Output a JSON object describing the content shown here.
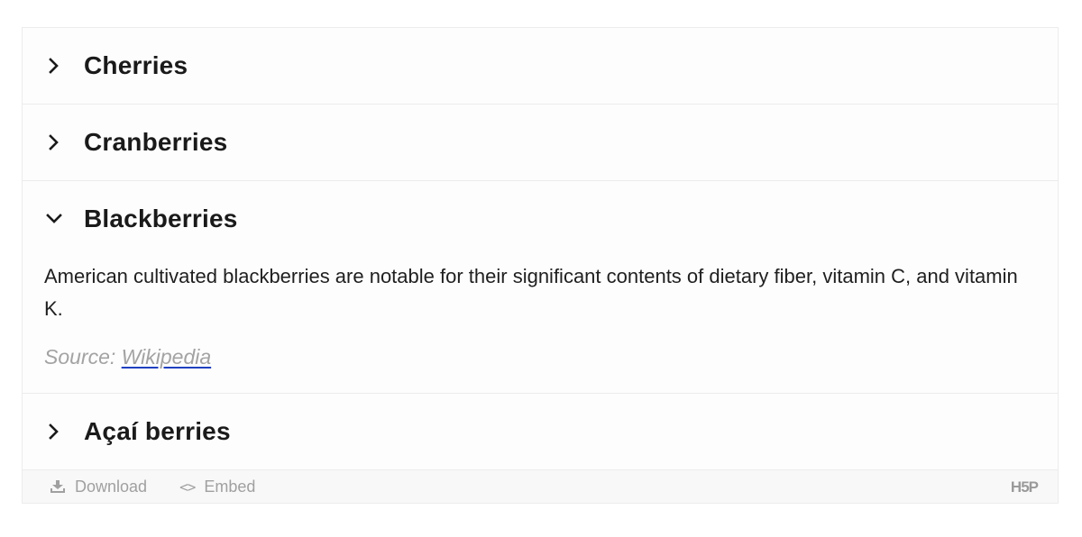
{
  "accordion": {
    "items": [
      {
        "title": "Cherries",
        "expanded": false
      },
      {
        "title": "Cranberries",
        "expanded": false
      },
      {
        "title": "Blackberries",
        "expanded": true,
        "body": "American cultivated blackberries are notable for their significant contents of dietary fiber, vitamin C, and vitamin K.",
        "source_label": "Source: ",
        "source_link": "Wikipedia"
      },
      {
        "title": "Açaí berries",
        "expanded": false
      }
    ]
  },
  "footer": {
    "download_label": "Download",
    "download_icon": "download-icon",
    "embed_label": "Embed",
    "embed_icon": "embed-code-icon",
    "embed_glyph": "<>",
    "logo_text": "H5P"
  },
  "colors": {
    "link_underline": "#1f3fbf",
    "muted_text": "#a3a3a3",
    "border": "#ececec"
  }
}
